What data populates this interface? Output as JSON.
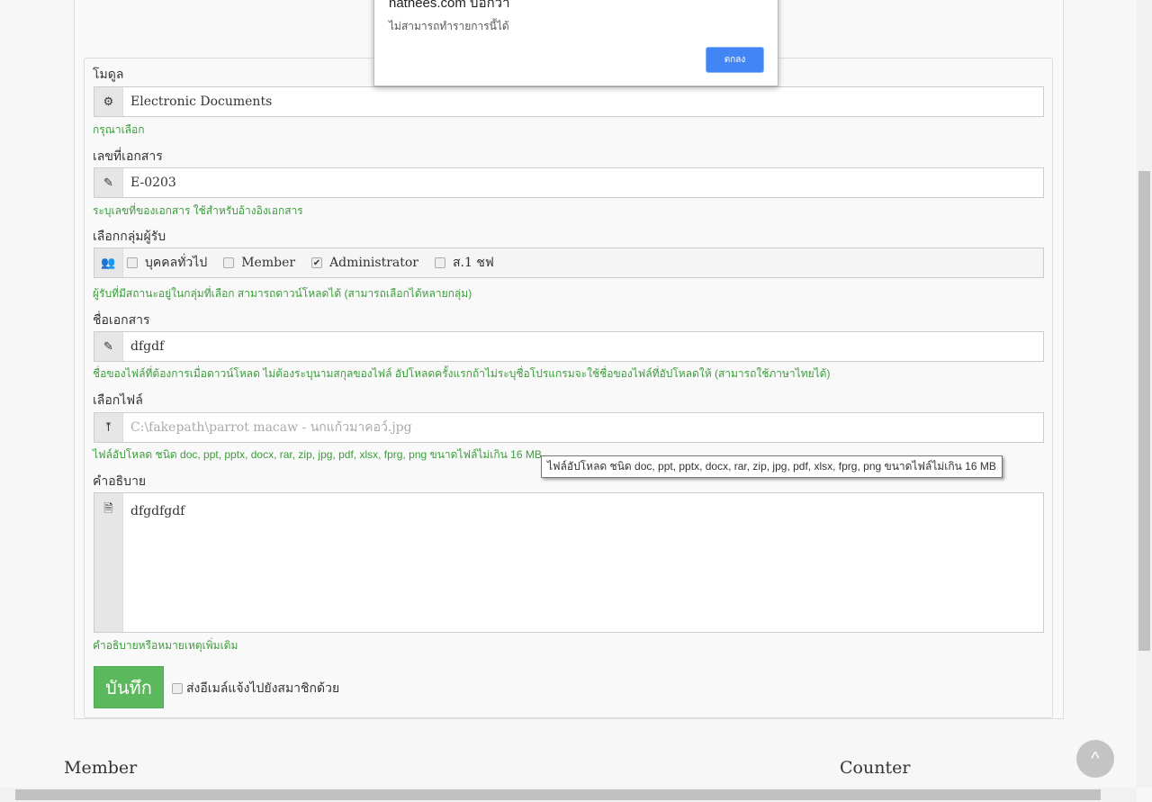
{
  "dialog": {
    "title": "nathees.com บอกว่า",
    "message": "ไม่สามารถทำรายการนี้ได้",
    "ok_label": "ตกลง"
  },
  "form": {
    "module": {
      "label": "โมดูล",
      "value": "Electronic Documents",
      "help": "กรุณาเลือก",
      "icon": "gears-icon"
    },
    "doc_no": {
      "label": "เลขที่เอกสาร",
      "value": "E-0203",
      "help": "ระบุเลขที่ของเอกสาร ใช้สำหรับอ้างอิงเอกสาร",
      "icon": "pencil-icon"
    },
    "groups": {
      "label": "เลือกกลุ่มผู้รับ",
      "help": "ผู้รับที่มีสถานะอยู่ในกลุ่มที่เลือก สามารถดาวน์โหลดได้ (สามารถเลือกได้หลายกลุ่ม)",
      "icon": "users-icon",
      "options": [
        {
          "label": "บุคคลทั่วไป",
          "checked": false
        },
        {
          "label": "Member",
          "checked": false
        },
        {
          "label": "Administrator",
          "checked": true
        },
        {
          "label": "ส.1 ชฟ",
          "checked": false
        }
      ]
    },
    "doc_name": {
      "label": "ชื่อเอกสาร",
      "value": "dfgdf",
      "help": "ชื่อของไฟล์ที่ต้องการเมื่อดาวน์โหลด ไม่ต้องระบุนามสกุลของไฟล์ อัปโหลดครั้งแรกถ้าไม่ระบุชื่อโปรแกรมจะใช้ชื่อของไฟล์ที่อัปโหลดให้ (สามารถใช้ภาษาไทยได้)",
      "icon": "pencil-icon"
    },
    "file": {
      "label": "เลือกไฟล์",
      "value": "C:\\fakepath\\parrot macaw - นกแก้วมาคอว์.jpg",
      "help": "ไฟล์อัปโหลด ชนิด doc, ppt, pptx, docx, rar, zip, jpg, pdf, xlsx, fprg, png ขนาดไฟล์ไม่เกิน 16 MB",
      "tooltip": "ไฟล์อัปโหลด ชนิด doc, ppt, pptx, docx, rar, zip, jpg, pdf, xlsx, fprg, png ขนาดไฟล์ไม่เกิน 16 MB",
      "icon": "upload-icon"
    },
    "description": {
      "label": "คำอธิบาย",
      "value": "dfgdfgdf",
      "help": "คำอธิบายหรือหมายเหตุเพิ่มเติม",
      "icon": "file-icon"
    },
    "save_label": "บันทึก",
    "send_email_label": "ส่งอีเมล์แจ้งไปยังสมาชิกด้วย"
  },
  "footer": {
    "member": "Member",
    "counter": "Counter",
    "back_to_top": "^"
  },
  "colors": {
    "help": "#3c9c3c",
    "save": "#5cb85c",
    "dialog_button": "#4285f4"
  }
}
